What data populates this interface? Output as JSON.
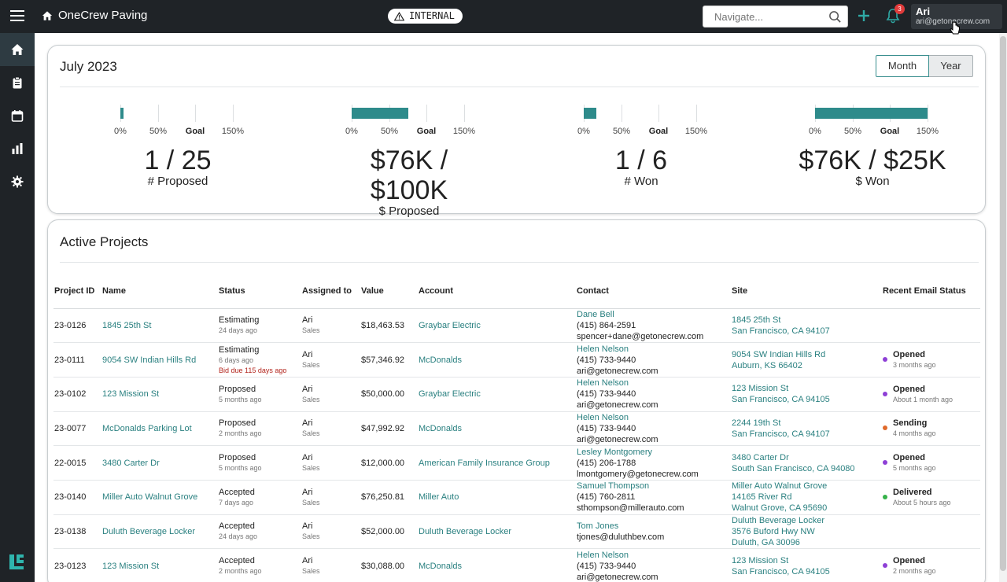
{
  "app": {
    "title": "OneCrew Paving",
    "env_badge": "INTERNAL",
    "notification_count": "3"
  },
  "navigate": {
    "placeholder": "Navigate..."
  },
  "user": {
    "name": "Ari",
    "email": "ari@getonecrew.com"
  },
  "colors": {
    "accent": "#2e8b8b",
    "topbar": "#1f2327",
    "opened": "#8e3fd6",
    "sending": "#e06a2b",
    "delivered": "#35b24a"
  },
  "sidebar": {
    "items": [
      {
        "name": "home-icon",
        "active": true
      },
      {
        "name": "clipboard-icon",
        "active": false
      },
      {
        "name": "calendar-icon",
        "active": false
      },
      {
        "name": "bar-chart-icon",
        "active": false
      },
      {
        "name": "gear-icon",
        "active": false
      }
    ]
  },
  "summary": {
    "title": "July 2023",
    "toggle": {
      "month": "Month",
      "year": "Year",
      "selected": "Month"
    },
    "ticks": [
      "0%",
      "50%",
      "Goal",
      "150%"
    ],
    "metrics": [
      {
        "value": "1 / 25",
        "label": "# Proposed",
        "fill_pct": 4
      },
      {
        "value": "$76K / $100K",
        "label": "$ Proposed",
        "fill_pct": 76
      },
      {
        "value": "1 / 6",
        "label": "# Won",
        "fill_pct": 17
      },
      {
        "value": "$76K / $25K",
        "label": "$ Won",
        "fill_pct": 150
      }
    ]
  },
  "projects": {
    "title": "Active Projects",
    "columns": [
      "Project ID",
      "Name",
      "Status",
      "Assigned to",
      "Value",
      "Account",
      "Contact",
      "Site",
      "Recent Email Status"
    ],
    "rows": [
      {
        "id": "23-0126",
        "name": "1845 25th St",
        "status": "Estimating",
        "status_when": "24 days ago",
        "due": "",
        "assignee": "Ari",
        "role": "Sales",
        "value": "$18,463.53",
        "account": "Graybar Electric",
        "contact_name": "Dane Bell",
        "contact_phone": "(415) 864-2591",
        "contact_email": "spencer+dane@getonecrew.com",
        "site": [
          "1845 25th St",
          "San Francisco, CA 94107"
        ],
        "email_status": "",
        "email_when": "",
        "email_color": ""
      },
      {
        "id": "23-0111",
        "name": "9054 SW Indian Hills Rd",
        "status": "Estimating",
        "status_when": "6 days ago",
        "due": "Bid due 115 days ago",
        "assignee": "Ari",
        "role": "Sales",
        "value": "$57,346.92",
        "account": "McDonalds",
        "contact_name": "Helen Nelson",
        "contact_phone": "(415) 733-9440",
        "contact_email": "ari@getonecrew.com",
        "site": [
          "9054 SW Indian Hills Rd",
          "Auburn, KS 66402"
        ],
        "email_status": "Opened",
        "email_when": "3 months ago",
        "email_color": "#8e3fd6"
      },
      {
        "id": "23-0102",
        "name": "123 Mission St",
        "status": "Proposed",
        "status_when": "5 months ago",
        "due": "",
        "assignee": "Ari",
        "role": "Sales",
        "value": "$50,000.00",
        "account": "Graybar Electric",
        "contact_name": "Helen Nelson",
        "contact_phone": "(415) 733-9440",
        "contact_email": "ari@getonecrew.com",
        "site": [
          "123 Mission St",
          "San Francisco, CA 94105"
        ],
        "email_status": "Opened",
        "email_when": "About 1 month ago",
        "email_color": "#8e3fd6"
      },
      {
        "id": "23-0077",
        "name": "McDonalds Parking Lot",
        "status": "Proposed",
        "status_when": "2 months ago",
        "due": "",
        "assignee": "Ari",
        "role": "Sales",
        "value": "$47,992.92",
        "account": "McDonalds",
        "contact_name": "Helen Nelson",
        "contact_phone": "(415) 733-9440",
        "contact_email": "ari@getonecrew.com",
        "site": [
          "2244 19th St",
          "San Francisco, CA 94107"
        ],
        "email_status": "Sending",
        "email_when": "4 months ago",
        "email_color": "#e06a2b"
      },
      {
        "id": "22-0015",
        "name": "3480 Carter Dr",
        "status": "Proposed",
        "status_when": "5 months ago",
        "due": "",
        "assignee": "Ari",
        "role": "Sales",
        "value": "$12,000.00",
        "account": "American Family Insurance Group",
        "contact_name": "Lesley Montgomery",
        "contact_phone": "(415) 206-1788",
        "contact_email": "lmontgomery@getonecrew.com",
        "site": [
          "3480 Carter Dr",
          "South San Francisco, CA 94080"
        ],
        "email_status": "Opened",
        "email_when": "5 months ago",
        "email_color": "#8e3fd6"
      },
      {
        "id": "23-0140",
        "name": "Miller Auto Walnut Grove",
        "status": "Accepted",
        "status_when": "7 days ago",
        "due": "",
        "assignee": "Ari",
        "role": "Sales",
        "value": "$76,250.81",
        "account": "Miller Auto",
        "contact_name": "Samuel Thompson",
        "contact_phone": "(415) 760-2811",
        "contact_email": "sthompson@millerauto.com",
        "site": [
          "Miller Auto Walnut Grove",
          "14165 River Rd",
          "Walnut Grove, CA 95690"
        ],
        "email_status": "Delivered",
        "email_when": "About 5 hours ago",
        "email_color": "#35b24a"
      },
      {
        "id": "23-0138",
        "name": "Duluth Beverage Locker",
        "status": "Accepted",
        "status_when": "24 days ago",
        "due": "",
        "assignee": "Ari",
        "role": "Sales",
        "value": "$52,000.00",
        "account": "Duluth Beverage Locker",
        "contact_name": "Tom Jones",
        "contact_phone": "",
        "contact_email": "tjones@duluthbev.com",
        "site": [
          "Duluth Beverage Locker",
          "3576 Buford Hwy NW",
          "Duluth, GA 30096"
        ],
        "email_status": "",
        "email_when": "",
        "email_color": ""
      },
      {
        "id": "23-0123",
        "name": "123 Mission St",
        "status": "Accepted",
        "status_when": "2 months ago",
        "due": "",
        "assignee": "Ari",
        "role": "Sales",
        "value": "$30,088.00",
        "account": "McDonalds",
        "contact_name": "Helen Nelson",
        "contact_phone": "(415) 733-9440",
        "contact_email": "ari@getonecrew.com",
        "site": [
          "123 Mission St",
          "San Francisco, CA 94105"
        ],
        "email_status": "Opened",
        "email_when": "2 months ago",
        "email_color": "#8e3fd6"
      }
    ]
  }
}
